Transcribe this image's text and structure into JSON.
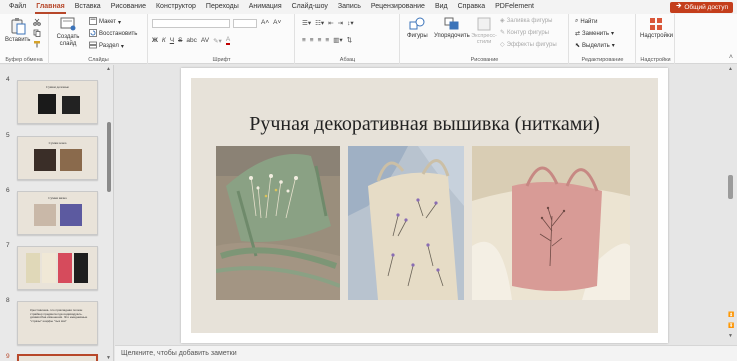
{
  "menu": {
    "tabs": [
      "Файл",
      "Главная",
      "Вставка",
      "Рисование",
      "Конструктор",
      "Переходы",
      "Анимация",
      "Слайд-шоу",
      "Запись",
      "Рецензирование",
      "Вид",
      "Справка",
      "PDFelement"
    ],
    "active_tab": "Главная",
    "share_label": "Общий доступ"
  },
  "ribbon": {
    "clipboard": {
      "paste": "Вставить",
      "label": "Буфер обмена"
    },
    "slides": {
      "new_slide": "Создать слайд",
      "layout": "Макет",
      "reset": "Восстановить",
      "section": "Раздел",
      "label": "Слайды"
    },
    "font": {
      "bold": "Ж",
      "italic": "К",
      "underline": "Ч",
      "strike": "S",
      "spacing": "abc",
      "case": "AV",
      "color": "А",
      "label": "Шрифт"
    },
    "paragraph": {
      "label": "Абзац"
    },
    "drawing": {
      "shapes": "Фигуры",
      "arrange": "Упорядочить",
      "quick_styles": "Экспресс-стили",
      "fill": "Заливка фигуры",
      "outline": "Контур фигуры",
      "effects": "Эффекты фигуры",
      "label": "Рисование"
    },
    "editing": {
      "find": "Найти",
      "replace": "Заменить",
      "select": "Выделить",
      "label": "Редактирование"
    },
    "addins": {
      "addins": "Надстройки",
      "label": "Надстройки"
    }
  },
  "thumbnails": [
    {
      "number": "4",
      "title": "Сумки деловые"
    },
    {
      "number": "5",
      "title": "Сумки кожа"
    },
    {
      "number": "6",
      "title": "Сумки вязка"
    },
    {
      "number": "7",
      "title": ""
    },
    {
      "number": "8",
      "title": "Крестовишка- это прикладная полезн страйкер предмета пда индивидуаль. дизавсобна изменения. Это ежедневные \"стразы\" шарфы \"пыз зви\""
    },
    {
      "number": "9",
      "title": ""
    }
  ],
  "selected_slide": "9",
  "slide": {
    "title": "Ручная декоративная вышивка (нитками)",
    "background_color": "#e7e2d9",
    "photos": [
      "green-tote-embroidered",
      "beige-tote-embroidered",
      "pink-tote-embroidered"
    ]
  },
  "notes_placeholder": "Щелкните, чтобы добавить заметки",
  "colors": {
    "accent": "#b7472a",
    "share": "#c43e1c"
  }
}
